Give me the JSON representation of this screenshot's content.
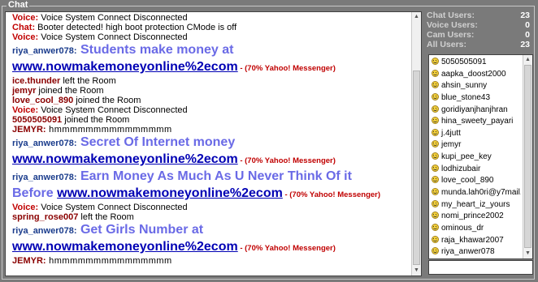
{
  "window": {
    "title": "Chat"
  },
  "chat": {
    "lines": [
      {
        "type": "sys",
        "label": "Voice:",
        "text": " Voice System Connect Disconnected"
      },
      {
        "type": "sys",
        "label": "Chat:",
        "text": " Booter detected! high boot protection CMode is off"
      },
      {
        "type": "sys",
        "label": "Voice:",
        "text": " Voice System Connect Disconnected"
      },
      {
        "type": "spam",
        "nick": "riya_anwer078:",
        "text": " Students make money at"
      },
      {
        "type": "link",
        "link": "www.nowmakemoneyonline%2ecom",
        "suffix": " - (70% Yahoo! Messenger)"
      },
      {
        "type": "event",
        "nick": "ice.thunder",
        "text": " left the Room"
      },
      {
        "type": "event",
        "nick": "jemyr",
        "text": " joined the Room"
      },
      {
        "type": "event",
        "nick": "love_cool_890",
        "text": " joined the Room"
      },
      {
        "type": "sys",
        "label": "Voice:",
        "text": " Voice System Connect Disconnected"
      },
      {
        "type": "event",
        "nick": "5050505091",
        "text": " joined the Room"
      },
      {
        "type": "msg",
        "nick": "JEMYR:",
        "text": " hmmmmmmmmmmmmmmm"
      },
      {
        "type": "spam",
        "nick": "riya_anwer078:",
        "text": " Secret Of Internet money"
      },
      {
        "type": "link",
        "link": "www.nowmakemoneyonline%2ecom",
        "suffix": " - (70% Yahoo! Messenger)"
      },
      {
        "type": "spam",
        "nick": "riya_anwer078:",
        "text": " Earn Money As Much As U Never Think Of it"
      },
      {
        "type": "mixed",
        "pre": "Before ",
        "link": "www.nowmakemoneyonline%2ecom",
        "suffix": " - (70% Yahoo! Messenger)"
      },
      {
        "type": "sys",
        "label": "Voice:",
        "text": " Voice System Connect Disconnected"
      },
      {
        "type": "event",
        "nick": "spring_rose007",
        "text": " left the Room"
      },
      {
        "type": "spam",
        "nick": "riya_anwer078:",
        "text": " Get Girls Number at"
      },
      {
        "type": "link",
        "link": "www.nowmakemoneyonline%2ecom",
        "suffix": " - (70% Yahoo! Messenger)"
      },
      {
        "type": "msg",
        "nick": "JEMYR:",
        "text": " hmmmmmmmmmmmmmmm"
      }
    ],
    "scroll_position": 0.95
  },
  "stats": [
    {
      "label": "Chat Users:",
      "value": "23"
    },
    {
      "label": "Voice Users:",
      "value": "0"
    },
    {
      "label": "Cam Users:",
      "value": "0"
    },
    {
      "label": "All Users:",
      "value": "23"
    }
  ],
  "users": [
    "5050505091",
    "aapka_doost2000",
    "ahsin_sunny",
    "blue_stone43",
    "goridiyanjhanjhran",
    "hina_sweety_payari",
    "j.4jutt",
    "jemyr",
    "kupi_pee_key",
    "lodhizubair",
    "love_cool_890",
    "munda.lah0ri@y7mail.com",
    "my_heart_iz_yours",
    "nomi_prince2002",
    "ominous_dr",
    "raja_khawar2007",
    "riya_anwer078"
  ],
  "input": {
    "value": ""
  },
  "colors": {
    "frame": "#7a7a7a",
    "spam_text": "#6a6ae6",
    "link": "#0000b4",
    "warning": "#c00000",
    "nick": "#8a0000"
  }
}
